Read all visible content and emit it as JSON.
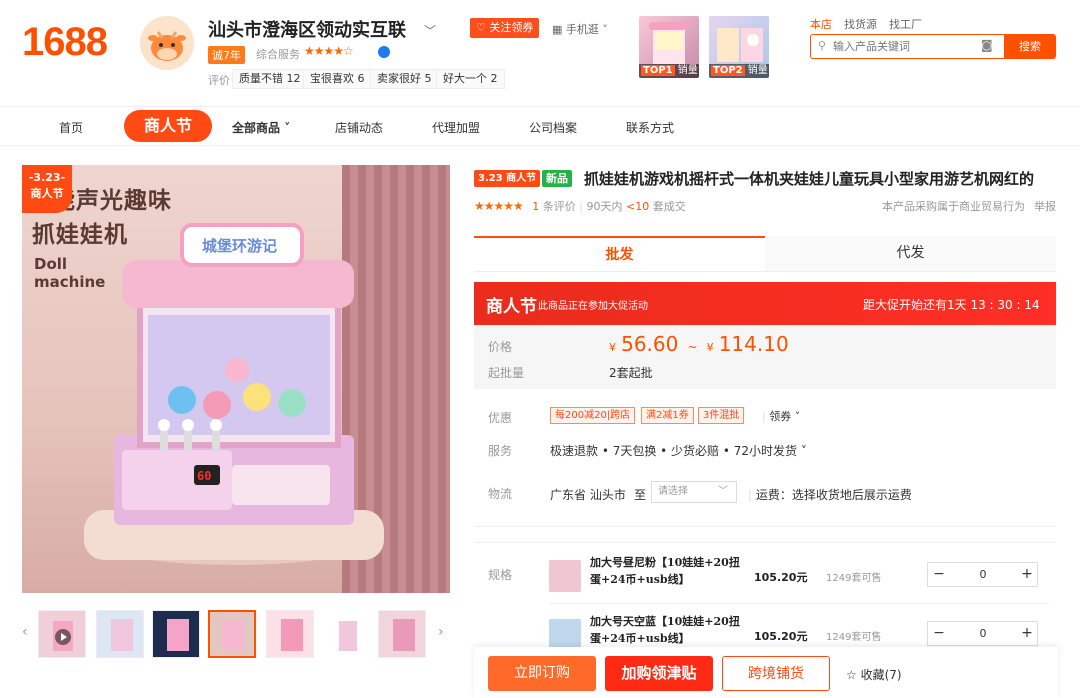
{
  "header": {
    "logo": "1688",
    "shop_name": "汕头市澄海区领动实互联",
    "years_badge": "诚7年",
    "score_label": "综合服务",
    "stars": "★★★★☆",
    "eval_label": "评价",
    "eval_tags": [
      "质量不错 12",
      "宝很喜欢 6",
      "卖家很好 5",
      "好大一个 2"
    ],
    "follow_label": "关注领券",
    "mobile_label": "手机逛",
    "promo": [
      {
        "rank": "TOP1",
        "label": "销量"
      },
      {
        "rank": "TOP2",
        "label": "销量"
      }
    ],
    "search_tabs": [
      "本店",
      "找货源",
      "找工厂"
    ],
    "search_placeholder": "输入产品关键词",
    "search_button": "搜索"
  },
  "nav": {
    "items": [
      "首页",
      "商人节",
      "全部商品",
      "店铺动态",
      "代理加盟",
      "公司档案",
      "联系方式"
    ]
  },
  "gallery": {
    "badge_date": "-3.23-",
    "badge_label": "商人节",
    "img_title_line1": "智能声光趣味",
    "img_title_line2": "抓娃娃机",
    "img_en_line1": "Doll",
    "img_en_line2": "machine",
    "img_sign": "城堡环游记",
    "img_display": "60",
    "prev_icon": "chevron-left-icon",
    "next_icon": "chevron-right-icon"
  },
  "product": {
    "festival_tag": "3.23 商人节",
    "new_tag": "新品",
    "title": "抓娃娃机游戏机摇杆式一体机夹娃娃儿童玩具小型家用游艺机网红的",
    "stars": "★★★★★",
    "review_count": "1",
    "review_label": "条评价",
    "sales_period": "90天内",
    "sales_count": "<10",
    "sales_label": "套成交",
    "notice": "本产品采购属于商业贸易行为",
    "report": "举报",
    "tabs": [
      "批发",
      "代发"
    ],
    "festival_bar_title": "商人节",
    "festival_bar_sub": "此商品正在参加大促活动",
    "countdown": "距大促开始还有1天 13 : 30 : 14",
    "price_label": "价格",
    "price_currency": "¥",
    "price_low": "56.60",
    "price_sep": "~",
    "price_high": "114.10",
    "moq_label": "起批量",
    "moq_value": "2套起批",
    "benefit_label": "优惠",
    "coupons": [
      "每200减20|跨店",
      "满2减1券",
      "3件混批"
    ],
    "coupon_more": "领券",
    "service_label": "服务",
    "service_value": "极速退款 • 7天包换 • 少货必赔 • 72小时发货",
    "logistics_label": "物流",
    "logistics_from": "广东省 汕头市",
    "logistics_to": "至",
    "logistics_select": "请选择",
    "logistics_fee": "运费：选择收货地后展示运费",
    "spec_label": "规格",
    "specs": [
      {
        "name": "加大号昼尼粉【10娃娃+20扭蛋+24币+usb线】",
        "price": "105.20元",
        "stock": "1249套可售",
        "qty": "0"
      },
      {
        "name": "加大号天空蓝【10娃娃+20扭蛋+24币+usb线】",
        "price": "105.20元",
        "stock": "1249套可售",
        "qty": "0"
      }
    ]
  },
  "actions": {
    "buy": "立即订购",
    "cart": "加购领津贴",
    "cross": "跨境铺货",
    "fav": "收藏(7)"
  }
}
